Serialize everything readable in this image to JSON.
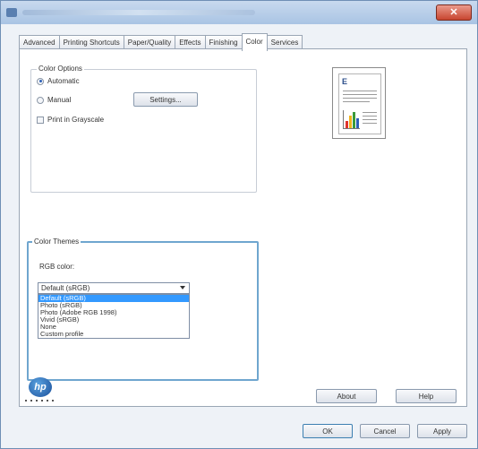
{
  "tabs": [
    "Advanced",
    "Printing Shortcuts",
    "Paper/Quality",
    "Effects",
    "Finishing",
    "Color",
    "Services"
  ],
  "active_tab": "Color",
  "color_options": {
    "legend": "Color Options",
    "automatic_label": "Automatic",
    "manual_label": "Manual",
    "settings_label": "Settings...",
    "grayscale_label": "Print in Grayscale",
    "selected": "Automatic"
  },
  "color_themes": {
    "legend": "Color Themes",
    "rgb_label": "RGB color:",
    "selected_value": "Default (sRGB)",
    "options": [
      "Default (sRGB)",
      "Photo (sRGB)",
      "Photo (Adobe RGB 1998)",
      "Vivid (sRGB)",
      "None",
      "Custom profile"
    ]
  },
  "buttons": {
    "about": "About",
    "help": "Help",
    "ok": "OK",
    "cancel": "Cancel",
    "apply": "Apply"
  },
  "title_close": "✕",
  "logo_text": "hp",
  "preview_letter": "E"
}
